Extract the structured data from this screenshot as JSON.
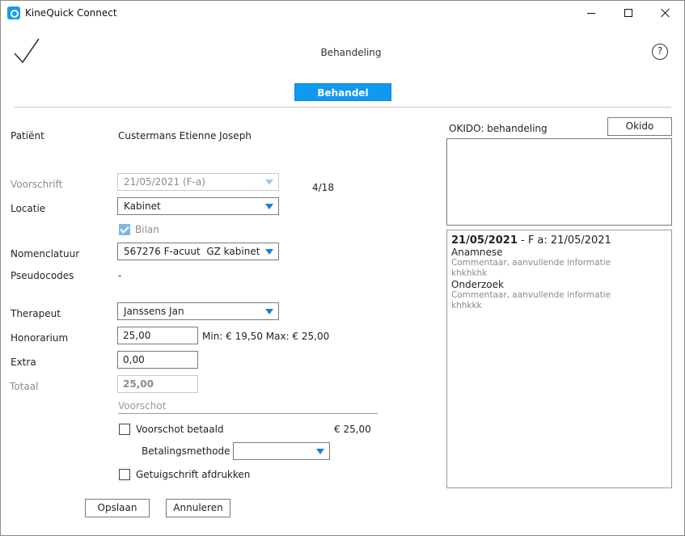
{
  "window": {
    "title": "KineQuick Connect",
    "icon": "kinequick-logo-icon"
  },
  "header": {
    "page_title": "Behandeling",
    "confirm_icon": "checkmark-icon",
    "help_label": "?"
  },
  "tabs": [
    {
      "label": "Behandel",
      "active": true
    }
  ],
  "form": {
    "patient_label": "Patiënt",
    "patient_value": "Custermans Etienne Joseph",
    "voorschrift_label": "Voorschrift",
    "voorschrift_value": "21/05/2021 (F-a)",
    "voorschrift_count": "4/18",
    "locatie_label": "Locatie",
    "locatie_value": "Kabinet",
    "bilan_label": "Bilan",
    "bilan_checked": true,
    "nomenclatuur_label": "Nomenclatuur",
    "nomenclatuur_value": "567276 F-acuut  GZ kabinet",
    "pseudocodes_label": "Pseudocodes",
    "pseudocodes_value": "-",
    "therapeut_label": "Therapeut",
    "therapeut_value": "Janssens Jan",
    "honorarium_label": "Honorarium",
    "honorarium_value": "25,00",
    "honorarium_range": "Min: € 19,50 Max: € 25,00",
    "extra_label": "Extra",
    "extra_value": "0,00",
    "totaal_label": "Totaal",
    "totaal_value": "25,00"
  },
  "voorschot": {
    "section_label": "Voorschot",
    "betaald_label": "Voorschot betaald",
    "betaald_checked": false,
    "amount": "€ 25,00",
    "betalingsmethode_label": "Betalingsmethode",
    "betalingsmethode_value": "",
    "getuigschrift_label": "Getuigschrift afdrukken",
    "getuigschrift_checked": false
  },
  "buttons": {
    "save_label": "Opslaan",
    "cancel_label": "Annuleren"
  },
  "okido": {
    "label": "OKIDO: behandeling",
    "button_label": "Okido"
  },
  "history": {
    "date": "21/05/2021",
    "header_rest": " - F a: 21/05/2021",
    "sections": [
      {
        "title": "Anamnese",
        "hint": "Commentaar, aanvullende informatie",
        "text": "khkhkhk"
      },
      {
        "title": "Onderzoek",
        "hint": "Commentaar, aanvullende informatie",
        "text": "khhkkk"
      }
    ]
  },
  "colors": {
    "accent": "#0f9af0",
    "arrow": "#1a7fd1"
  }
}
